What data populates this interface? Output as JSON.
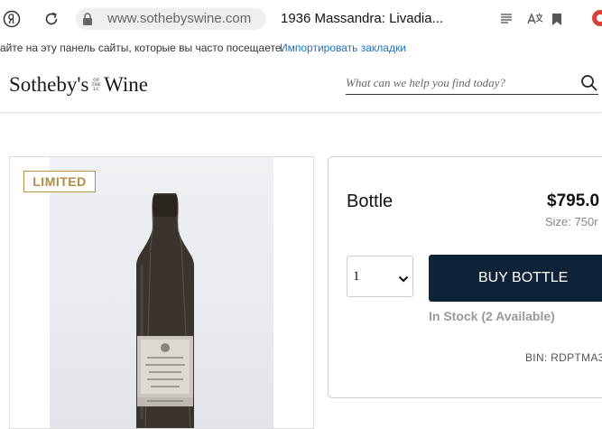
{
  "browser": {
    "url": "www.sothebyswine.com",
    "tab_title": "1936 Massandra: Livadia..."
  },
  "bookmarks_bar": {
    "prompt": "айте на эту панель сайты, которые вы часто посещаете.",
    "import_link": "Импортировать закладки"
  },
  "site": {
    "logo_left": "Sotheby's",
    "logo_of": [
      "OF",
      "THE",
      "LC"
    ],
    "logo_right": "Wine",
    "search_placeholder": "What can we help you find today?"
  },
  "product": {
    "badge": "LIMITED",
    "format_label": "Bottle",
    "price": "$795.0",
    "size": "Size: 750r",
    "quantity": "1",
    "buy_button": "BUY BOTTLE",
    "stock_status": "In Stock (2 Available)",
    "bin": "BIN: RDPTMA3"
  },
  "colors": {
    "buy_button": "#0f2338",
    "badge": "#b08b45",
    "link": "#1a73c8"
  }
}
